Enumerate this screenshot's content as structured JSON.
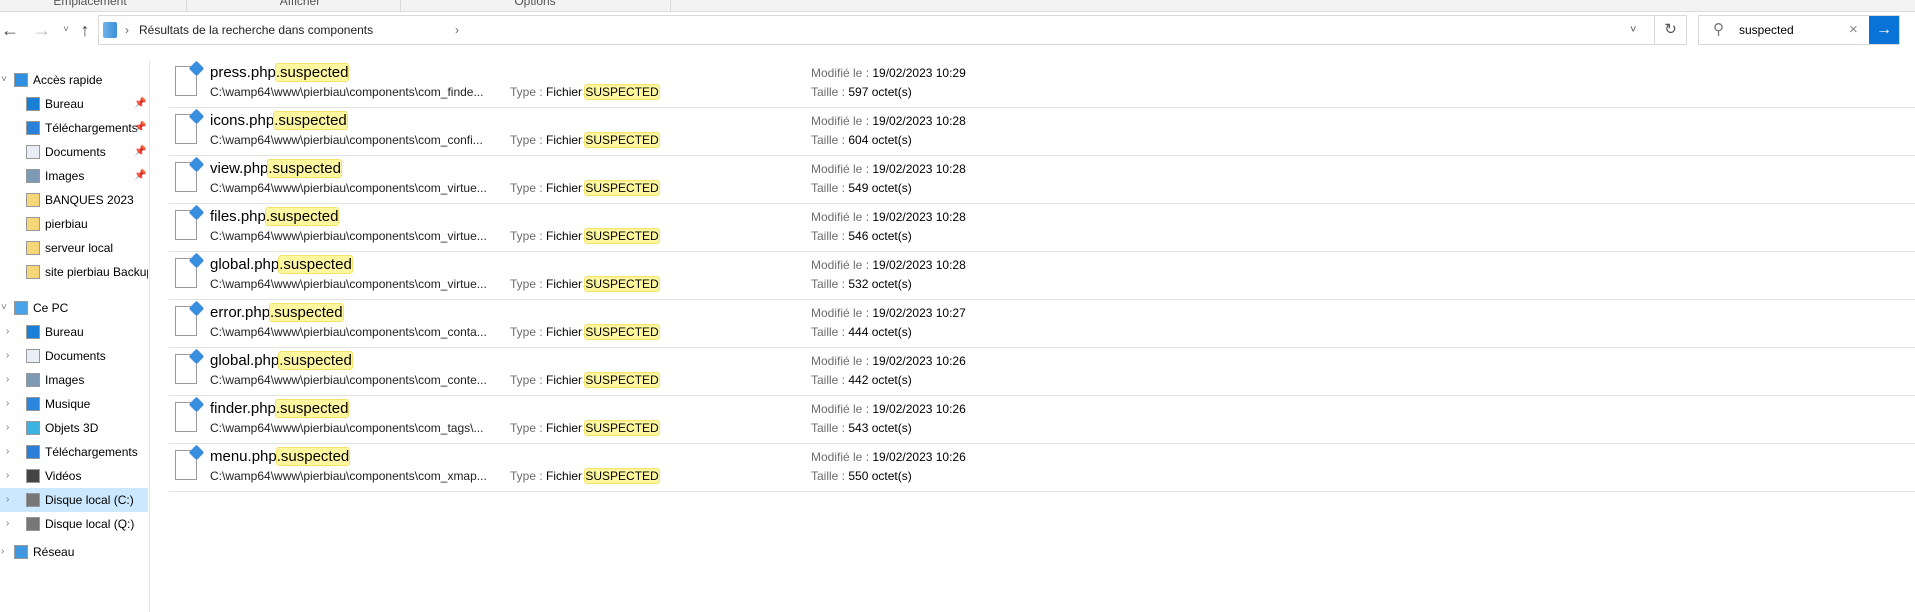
{
  "ribbon": {
    "tabs": [
      "Emplacement",
      "Afficher",
      "Options"
    ]
  },
  "address": {
    "crumb": "Résultats de la recherche dans components"
  },
  "search": {
    "value": "suspected"
  },
  "sidebar": {
    "items": [
      {
        "label": "Accès rapide",
        "icon": "star-icon",
        "level": 0,
        "chev": "˅"
      },
      {
        "label": "Bureau",
        "icon": "desktop-icon",
        "level": 1,
        "pin": true
      },
      {
        "label": "Téléchargements",
        "icon": "download-icon",
        "level": 1,
        "pin": true
      },
      {
        "label": "Documents",
        "icon": "documents-icon",
        "level": 1,
        "pin": true
      },
      {
        "label": "Images",
        "icon": "images-icon",
        "level": 1,
        "pin": true
      },
      {
        "label": "BANQUES 2023",
        "icon": "folder-icon",
        "level": 1
      },
      {
        "label": "pierbiau",
        "icon": "folder-icon",
        "level": 1
      },
      {
        "label": "serveur local",
        "icon": "folder-icon",
        "level": 1
      },
      {
        "label": "site pierbiau Backup",
        "icon": "folder-icon",
        "level": 1
      },
      {
        "label": "Ce PC",
        "icon": "computer-icon",
        "level": 0,
        "chev": "˅"
      },
      {
        "label": "Bureau",
        "icon": "desktop-icon",
        "level": 1,
        "chev": "›"
      },
      {
        "label": "Documents",
        "icon": "documents-icon",
        "level": 1,
        "chev": "›"
      },
      {
        "label": "Images",
        "icon": "images-icon",
        "level": 1,
        "chev": "›"
      },
      {
        "label": "Musique",
        "icon": "music-icon",
        "level": 1,
        "chev": "›"
      },
      {
        "label": "Objets 3D",
        "icon": "cube-icon",
        "level": 1,
        "chev": "›"
      },
      {
        "label": "Téléchargements",
        "icon": "download-icon",
        "level": 1,
        "chev": "›"
      },
      {
        "label": "Vidéos",
        "icon": "video-icon",
        "level": 1,
        "chev": "›"
      },
      {
        "label": "Disque local (C:)",
        "icon": "drive-icon",
        "level": 1,
        "chev": "›",
        "selected": true
      },
      {
        "label": "Disque local (Q:)",
        "icon": "drive-icon",
        "level": 1,
        "chev": "›"
      },
      {
        "label": "Réseau",
        "icon": "network-icon",
        "level": 0,
        "chev": "›"
      }
    ]
  },
  "labels": {
    "type": "Type : ",
    "fichier": "Fichier ",
    "modified": "Modifié le : ",
    "size": "Taille : "
  },
  "files": [
    {
      "base": "press.php",
      "ext": ".suspected",
      "path": "C:\\wamp64\\www\\pierbiau\\components\\com_finde...",
      "typehl": "SUSPECTED",
      "modified": "19/02/2023 10:29",
      "size": "597 octet(s)"
    },
    {
      "base": "icons.php",
      "ext": ".suspected",
      "path": "C:\\wamp64\\www\\pierbiau\\components\\com_confi...",
      "typehl": "SUSPECTED",
      "modified": "19/02/2023 10:28",
      "size": "604 octet(s)"
    },
    {
      "base": "view.php",
      "ext": ".suspected",
      "path": "C:\\wamp64\\www\\pierbiau\\components\\com_virtue...",
      "typehl": "SUSPECTED",
      "modified": "19/02/2023 10:28",
      "size": "549 octet(s)"
    },
    {
      "base": "files.php",
      "ext": ".suspected",
      "path": "C:\\wamp64\\www\\pierbiau\\components\\com_virtue...",
      "typehl": "SUSPECTED",
      "modified": "19/02/2023 10:28",
      "size": "546 octet(s)"
    },
    {
      "base": "global.php",
      "ext": ".suspected",
      "path": "C:\\wamp64\\www\\pierbiau\\components\\com_virtue...",
      "typehl": "SUSPECTED",
      "modified": "19/02/2023 10:28",
      "size": "532 octet(s)"
    },
    {
      "base": "error.php",
      "ext": ".suspected",
      "path": "C:\\wamp64\\www\\pierbiau\\components\\com_conta...",
      "typehl": "SUSPECTED",
      "modified": "19/02/2023 10:27",
      "size": "444 octet(s)"
    },
    {
      "base": "global.php",
      "ext": ".suspected",
      "path": "C:\\wamp64\\www\\pierbiau\\components\\com_conte...",
      "typehl": "SUSPECTED",
      "modified": "19/02/2023 10:26",
      "size": "442 octet(s)"
    },
    {
      "base": "finder.php",
      "ext": ".suspected",
      "path": "C:\\wamp64\\www\\pierbiau\\components\\com_tags\\...",
      "typehl": "SUSPECTED",
      "modified": "19/02/2023 10:26",
      "size": "543 octet(s)"
    },
    {
      "base": "menu.php",
      "ext": ".suspected",
      "path": "C:\\wamp64\\www\\pierbiau\\components\\com_xmap...",
      "typehl": "SUSPECTED",
      "modified": "19/02/2023 10:26",
      "size": "550 octet(s)"
    }
  ],
  "colors": {
    "accent": "#0a73d8",
    "highlight": "#fff7a0",
    "selection": "#cce8ff"
  }
}
